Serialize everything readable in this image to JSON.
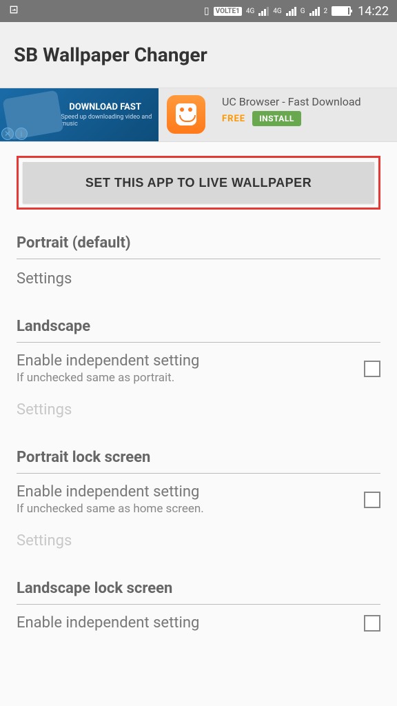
{
  "status": {
    "volte": "VOLTE1",
    "net1": "4G",
    "net2": "4G",
    "net3": "G",
    "time": "14:22",
    "sig2_label": "2"
  },
  "header": {
    "title": "SB Wallpaper Changer"
  },
  "ad": {
    "image_text": "DOWNLOAD FAST",
    "image_sub": "Speed up downloading video and music",
    "title": "UC Browser - Fast Download",
    "free": "FREE",
    "install": "INSTALL"
  },
  "main_button": "SET THIS APP TO LIVE WALLPAPER",
  "sections": {
    "portrait": {
      "title": "Portrait (default)",
      "settings": "Settings"
    },
    "landscape": {
      "title": "Landscape",
      "enable": "Enable independent setting",
      "sub": "If unchecked same as portrait.",
      "settings": "Settings"
    },
    "portrait_lock": {
      "title": "Portrait lock screen",
      "enable": "Enable independent setting",
      "sub": "If unchecked same as home screen.",
      "settings": "Settings"
    },
    "landscape_lock": {
      "title": "Landscape lock screen",
      "enable": "Enable independent setting"
    }
  }
}
